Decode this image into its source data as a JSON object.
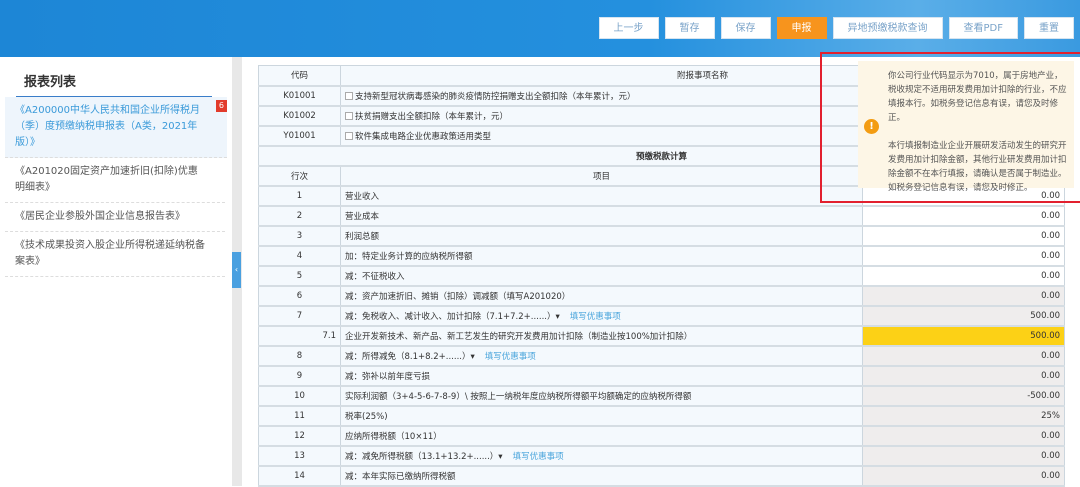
{
  "toolbar": {
    "buttons": [
      "上一步",
      "暂存",
      "保存",
      "申报",
      "异地预缴税款查询",
      "查看PDF",
      "重置"
    ]
  },
  "sidebar": {
    "title": "报表列表",
    "items": [
      {
        "label": "《A200000中华人民共和国企业所得税月（季）度预缴纳税申报表（A类，2021年版）》",
        "badge": "6"
      },
      {
        "label": "《A201020固定资产加速折旧(扣除)优惠明细表》"
      },
      {
        "label": "《居民企业参股外国企业信息报告表》"
      },
      {
        "label": "《技术成果投资入股企业所得税递延纳税备案表》"
      }
    ]
  },
  "attach": {
    "col_code": "代码",
    "col_name": "附报事项名称",
    "rows": [
      {
        "code": "K01001",
        "name": "支持新型冠状病毒感染的肺炎疫情防控捐赠支出全额扣除（本年累计，元）"
      },
      {
        "code": "K01002",
        "name": "扶贫捐赠支出全额扣除（本年累计，元）"
      },
      {
        "code": "Y01001",
        "name": "软件集成电路企业优惠政策适用类型"
      }
    ]
  },
  "calc": {
    "section_title": "预缴税款计算",
    "col_row": "行次",
    "col_item": "项目",
    "link_label": "填写优惠事项",
    "rows": [
      {
        "no": "1",
        "item": "营业收入",
        "value": "0.00"
      },
      {
        "no": "2",
        "item": "营业成本",
        "value": "0.00"
      },
      {
        "no": "3",
        "item": "利润总额",
        "value": "0.00"
      },
      {
        "no": "4",
        "item": "加：特定业务计算的应纳税所得额",
        "value": "0.00"
      },
      {
        "no": "5",
        "item": "减：不征税收入",
        "value": "0.00"
      },
      {
        "no": "6",
        "item": "减：资产加速折旧、摊销（扣除）调减额（填写A201020）",
        "value": "0.00"
      },
      {
        "no": "7",
        "item": "减：免税收入、减计收入、加计扣除（7.1+7.2+......）▾",
        "value": "500.00"
      },
      {
        "no": "7.1",
        "item": "企业开发新技术、新产品、新工艺发生的研究开发费用加计扣除（制造业按100%加计扣除）",
        "value": "500.00"
      },
      {
        "no": "8",
        "item": "减：所得减免（8.1+8.2+......）▾",
        "value": "0.00"
      },
      {
        "no": "9",
        "item": "减：弥补以前年度亏损",
        "value": "0.00"
      },
      {
        "no": "10",
        "item": "实际利润额（3+4-5-6-7-8-9）\\ 按照上一纳税年度应纳税所得额平均额确定的应纳税所得额",
        "value": "-500.00"
      },
      {
        "no": "11",
        "item": "税率(25%)",
        "value": "25%"
      },
      {
        "no": "12",
        "item": "应纳所得税额（10×11）",
        "value": "0.00"
      },
      {
        "no": "13",
        "item": "减：减免所得税额（13.1+13.2+......）▾",
        "value": "0.00"
      },
      {
        "no": "14",
        "item": "减：本年实际已缴纳所得税额",
        "value": "0.00"
      }
    ]
  },
  "tooltip": {
    "p1": "你公司行业代码显示为7010，属于房地产业，税收规定不适用研发费用加计扣除的行业，不应填报本行。如税务登记信息有误，请您及时修正。",
    "p2": "本行填报制造业企业开展研发活动发生的研究开发费用加计扣除金额，其他行业研发费用加计扣除金额不在本行填报，请确认是否属于制造业。如税务登记信息有误，请您及时修正。",
    "icon": "warning-icon"
  }
}
